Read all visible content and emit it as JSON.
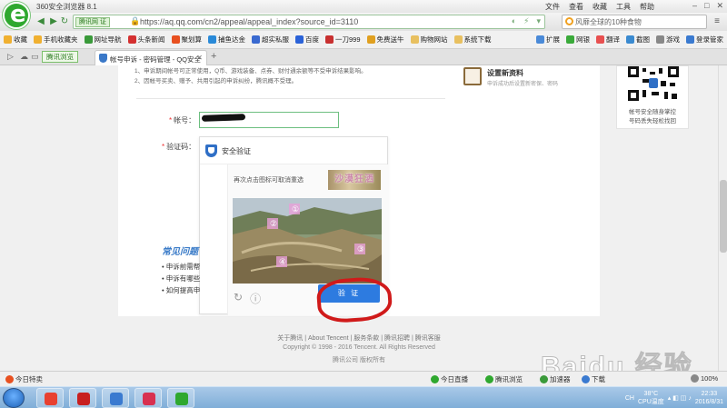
{
  "browser": {
    "title": "360安全浏览器 8.1",
    "menu": [
      "文件",
      "查看",
      "收藏",
      "工具",
      "帮助"
    ],
    "window_buttons": [
      "–",
      "□",
      "✕"
    ]
  },
  "nav": {
    "badge": "腾讯网 证",
    "url": "https://aq.qq.com/cn2/appeal/appeal_index?source_id=3110",
    "search_text": "风靡全球的10种食物"
  },
  "bookmarks": [
    {
      "label": "收藏",
      "color": "#f0b030"
    },
    {
      "label": "手机收藏夹",
      "color": "#f0b030"
    },
    {
      "label": "网址导航",
      "color": "#3a9a3a"
    },
    {
      "label": "头条新闻",
      "color": "#d43030"
    },
    {
      "label": "聚划算",
      "color": "#e85020"
    },
    {
      "label": "捕鱼达金",
      "color": "#2a8ad8"
    },
    {
      "label": "超实私服",
      "color": "#3a6ad0"
    },
    {
      "label": "百度",
      "color": "#2a62d8"
    },
    {
      "label": "一刀999",
      "color": "#c83030"
    },
    {
      "label": "免费送牛",
      "color": "#e0a020"
    },
    {
      "label": "购物网站",
      "color": "#e8c060"
    },
    {
      "label": "系统下载",
      "color": "#e8c060"
    }
  ],
  "bookmarks_right": [
    "扩展",
    "网银",
    "翻译",
    "截图",
    "游戏",
    "登录管家"
  ],
  "tabs": {
    "fast_mode": "腾讯浏览",
    "active_tab": "帐号申诉 - 密码管理 - QQ安全",
    "close": "✕",
    "add": "+"
  },
  "page": {
    "notice_lines": [
      "1、申诉期间帐号可正常使用，Q币、游戏装备、点券、财付通余额等不受申诉结果影响。",
      "2、因帐号买卖、赠予、共用引起的申诉纠纷，腾讯概不受理。"
    ],
    "account_label": "帐号：",
    "captcha_label": "验证码：",
    "captcha_title": "安全验证",
    "captcha_instruction": "再次点击图标可取消重选",
    "captcha_target": "沙漠狂洒",
    "verify_button": "验 证",
    "refresh_icon": "↻",
    "info_icon": "ⓘ",
    "faq_title": "常见问题",
    "faq_items": [
      "• 申诉前需帮",
      "• 申诉有哪些",
      "• 如何提高申"
    ],
    "side_title": "设置新资料",
    "side_sub": "申诉成功后设置新密保、密码",
    "qr_text_1": "帐号安全随身掌控",
    "qr_text_2": "号码丢失轻松找回",
    "footer_links": "关于腾讯 | About Tencent | 服务条款 | 腾讯招聘 | 腾讯客服",
    "footer_copy": "Copyright © 1998 - 2016 Tencent. All Rights Reserved",
    "footer_company": "腾讯公司 版权所有",
    "watermark": "Baidu 经验"
  },
  "status": {
    "left": "今日特卖",
    "live": "今日直播",
    "fast": "腾讯浏览",
    "speed": "加速器",
    "download": "下载",
    "zoom": "100%"
  },
  "taskbar": {
    "apps": [
      {
        "color": "#e84030"
      },
      {
        "color": "#c82020"
      },
      {
        "color": "#3a7ad0"
      },
      {
        "color": "#d83050"
      },
      {
        "color": "#2fa82f"
      }
    ],
    "ime": "CH",
    "temp": "38°C",
    "cpu": "CPU温度",
    "time": "22:33",
    "date": "2016/8/31"
  },
  "colors": {
    "accent": "#2d7be0",
    "browser_green": "#2fa82f",
    "highlight": "#d01a1a"
  }
}
